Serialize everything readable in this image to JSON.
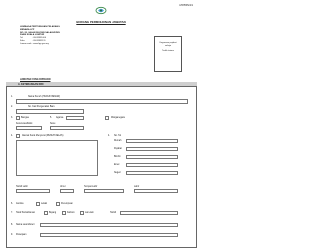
{
  "form_code": "LPP/BPG/2/1",
  "title": "BORANG PERMOHONAN JAWATAN",
  "organization": {
    "name_line1": "LEMBAGA PERTUBUHAN PELADANG",
    "name_line2": "MENARA LPP",
    "address_line1": "NO. 20, JALAN SULTAN SALAHUDDIN",
    "address_line2": "50480 KUALA LUMPUR",
    "contacts": [
      {
        "label": "Tel",
        "value": ": 03-26951000"
      },
      {
        "label": "Faks",
        "value": ": 03-26951111"
      },
      {
        "label": "Laman web",
        "value": ": www.lpp.gov.my"
      }
    ]
  },
  "office_use": {
    "line1": "Kegunaan pejabat",
    "line2": "sahaja",
    "line3": "Tarikh terima"
  },
  "position_section_label": "JAWATAN YANG DIPOHON",
  "section_a": {
    "heading": "A.   KETERANGAN DIRI",
    "fields": [
      {
        "num": "1.",
        "label": "Nama Penuh (HURUF BESAR)"
      },
      {
        "num": "2.",
        "label": "No. Kad Pengenalan Baru"
      },
      {
        "num": "3.",
        "label": "Bangsa"
      },
      {
        "num": "",
        "label": "Warganegara"
      },
      {
        "num": "",
        "label": "Alamat Surat Menyurat (PENUH/JELAS)"
      },
      {
        "num": "4.",
        "label": "No. Tel"
      },
      {
        "num": "",
        "label": "Rumah"
      },
      {
        "num": "",
        "label": "Pejabat"
      },
      {
        "num": "",
        "label": "Bimbit"
      },
      {
        "num": "6.",
        "label": "Jantina"
      },
      {
        "num": "7.",
        "label": "Taraf Perkahwinan"
      },
      {
        "num": "",
        "label": "Tarikh Lahir"
      },
      {
        "num": "",
        "label": "Lelaki"
      },
      {
        "num": "",
        "label": "Perempuan"
      },
      {
        "num": "",
        "label": "Bujang"
      },
      {
        "num": "",
        "label": "Kahwin"
      },
      {
        "num": "",
        "label": "Lain-lain"
      },
      {
        "num": "",
        "label": "Umur"
      },
      {
        "num": "",
        "label": "Tempat Lahir"
      },
      {
        "num": "5.",
        "label": "Agama"
      },
      {
        "num": "",
        "label": "Keturunan/Etnik"
      },
      {
        "num": "",
        "label": "Suku"
      },
      {
        "num": "",
        "label": "No. Tel"
      },
      {
        "num": "",
        "label": "Emel"
      },
      {
        "num": "",
        "label": "Negeri"
      },
      {
        "num": "",
        "label": "Lahir"
      },
      {
        "num": "",
        "label": "Tarikh"
      },
      {
        "num": "8.",
        "label": "Nama suami/isteri"
      },
      {
        "num": "9.",
        "label": "Pekerjaan"
      }
    ]
  }
}
